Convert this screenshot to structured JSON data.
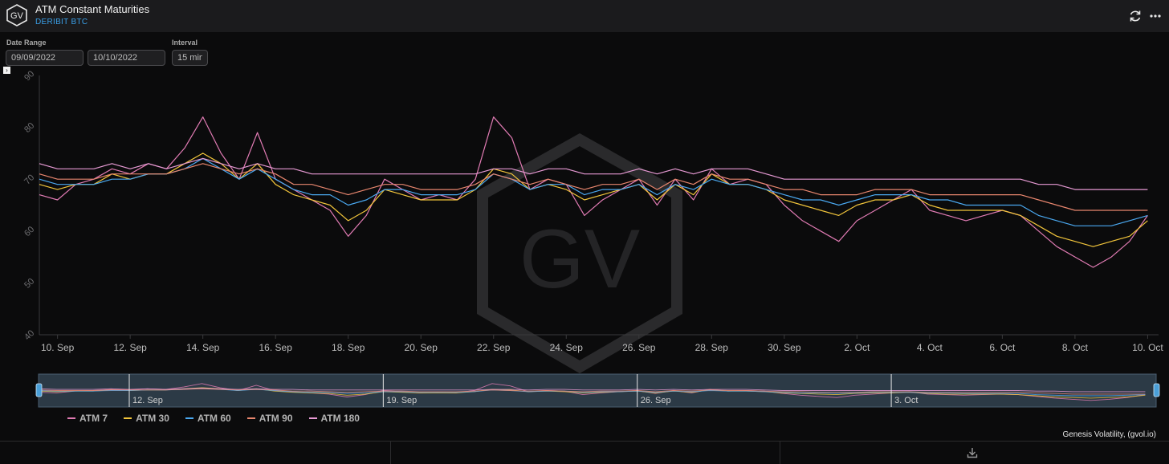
{
  "header": {
    "title": "ATM Constant Maturities",
    "subtitle": "DERIBIT BTC",
    "logo_text": "GV"
  },
  "controls": {
    "date_range_label": "Date Range",
    "start_date": "09/09/2022",
    "end_date": "10/10/2022",
    "interval_label": "Interval",
    "interval_value": "15 min"
  },
  "watermark": "GV",
  "credit": "Genesis Volatility, (gvol.io)",
  "navigator_labels": [
    "12. Sep",
    "19. Sep",
    "26. Sep",
    "3. Oct"
  ],
  "chart_data": {
    "type": "line",
    "title": "",
    "xlabel": "",
    "ylabel": "",
    "ylim": [
      40,
      90
    ],
    "yticks": [
      40,
      50,
      60,
      70,
      80,
      90
    ],
    "xlim": [
      9.5,
      40.3
    ],
    "xtick_labels": [
      "10. Sep",
      "12. Sep",
      "14. Sep",
      "16. Sep",
      "18. Sep",
      "20. Sep",
      "22. Sep",
      "24. Sep",
      "26. Sep",
      "28. Sep",
      "30. Sep",
      "2. Oct",
      "4. Oct",
      "6. Oct",
      "8. Oct",
      "10. Oct"
    ],
    "x": [
      9.5,
      10.0,
      10.5,
      11.0,
      11.5,
      12.0,
      12.5,
      13.0,
      13.5,
      14.0,
      14.5,
      15.0,
      15.5,
      16.0,
      16.5,
      17.0,
      17.5,
      18.0,
      18.5,
      19.0,
      19.5,
      20.0,
      20.5,
      21.0,
      21.5,
      22.0,
      22.5,
      23.0,
      23.5,
      24.0,
      24.5,
      25.0,
      25.5,
      26.0,
      26.5,
      27.0,
      27.5,
      28.0,
      28.5,
      29.0,
      29.5,
      30.0,
      30.5,
      31.0,
      31.5,
      32.0,
      32.5,
      33.0,
      33.5,
      34.0,
      34.5,
      35.0,
      35.5,
      36.0,
      36.5,
      37.0,
      37.5,
      38.0,
      38.5,
      39.0,
      39.5,
      40.0
    ],
    "x_axis": "day number (Sep 10 = 10, Oct 1 = 31)",
    "legend_position": "bottom-left",
    "series": [
      {
        "name": "ATM 7",
        "color": "#e07bb3",
        "values": [
          67,
          66,
          69,
          70,
          72,
          71,
          73,
          72,
          76,
          82,
          75,
          70,
          79,
          70,
          68,
          66,
          64,
          59,
          63,
          70,
          68,
          66,
          67,
          66,
          70,
          82,
          78,
          68,
          70,
          69,
          63,
          66,
          68,
          70,
          65,
          70,
          66,
          72,
          69,
          70,
          69,
          65,
          62,
          60,
          58,
          62,
          64,
          66,
          68,
          64,
          63,
          62,
          63,
          64,
          63,
          60,
          57,
          55,
          53,
          55,
          58,
          63
        ]
      },
      {
        "name": "ATM 30",
        "color": "#f2c53b",
        "values": [
          69,
          68,
          69,
          69,
          71,
          70,
          71,
          71,
          73,
          75,
          73,
          70,
          73,
          69,
          67,
          66,
          65,
          62,
          64,
          68,
          67,
          66,
          66,
          66,
          68,
          72,
          71,
          68,
          69,
          68,
          66,
          67,
          68,
          69,
          66,
          69,
          67,
          71,
          69,
          69,
          68,
          66,
          65,
          64,
          63,
          65,
          66,
          66,
          67,
          65,
          64,
          64,
          64,
          64,
          63,
          61,
          59,
          58,
          57,
          58,
          59,
          62
        ]
      },
      {
        "name": "ATM 60",
        "color": "#4aa8f0",
        "values": [
          70,
          69,
          69,
          69,
          70,
          70,
          71,
          71,
          72,
          74,
          72,
          70,
          72,
          70,
          68,
          67,
          67,
          65,
          66,
          68,
          68,
          67,
          67,
          67,
          68,
          71,
          70,
          68,
          69,
          69,
          67,
          68,
          68,
          69,
          67,
          69,
          68,
          70,
          69,
          69,
          68,
          67,
          66,
          66,
          65,
          66,
          67,
          67,
          67,
          66,
          66,
          65,
          65,
          65,
          65,
          63,
          62,
          61,
          61,
          61,
          62,
          63
        ]
      },
      {
        "name": "ATM 90",
        "color": "#e8866e",
        "values": [
          71,
          70,
          70,
          70,
          71,
          71,
          71,
          71,
          72,
          73,
          72,
          71,
          72,
          71,
          69,
          69,
          68,
          67,
          68,
          69,
          69,
          68,
          68,
          68,
          69,
          71,
          70,
          69,
          70,
          69,
          68,
          69,
          69,
          70,
          68,
          70,
          69,
          71,
          70,
          70,
          69,
          68,
          68,
          67,
          67,
          67,
          68,
          68,
          68,
          67,
          67,
          67,
          67,
          67,
          67,
          66,
          65,
          64,
          64,
          64,
          64,
          64
        ]
      },
      {
        "name": "ATM 180",
        "color": "#e79ad4",
        "values": [
          73,
          72,
          72,
          72,
          73,
          72,
          73,
          72,
          73,
          74,
          73,
          72,
          73,
          72,
          72,
          71,
          71,
          71,
          71,
          71,
          71,
          71,
          71,
          71,
          71,
          72,
          72,
          71,
          72,
          72,
          71,
          71,
          71,
          72,
          71,
          72,
          71,
          72,
          72,
          72,
          71,
          70,
          70,
          70,
          70,
          70,
          70,
          70,
          70,
          70,
          70,
          70,
          70,
          70,
          70,
          69,
          69,
          68,
          68,
          68,
          68,
          68
        ]
      }
    ]
  }
}
